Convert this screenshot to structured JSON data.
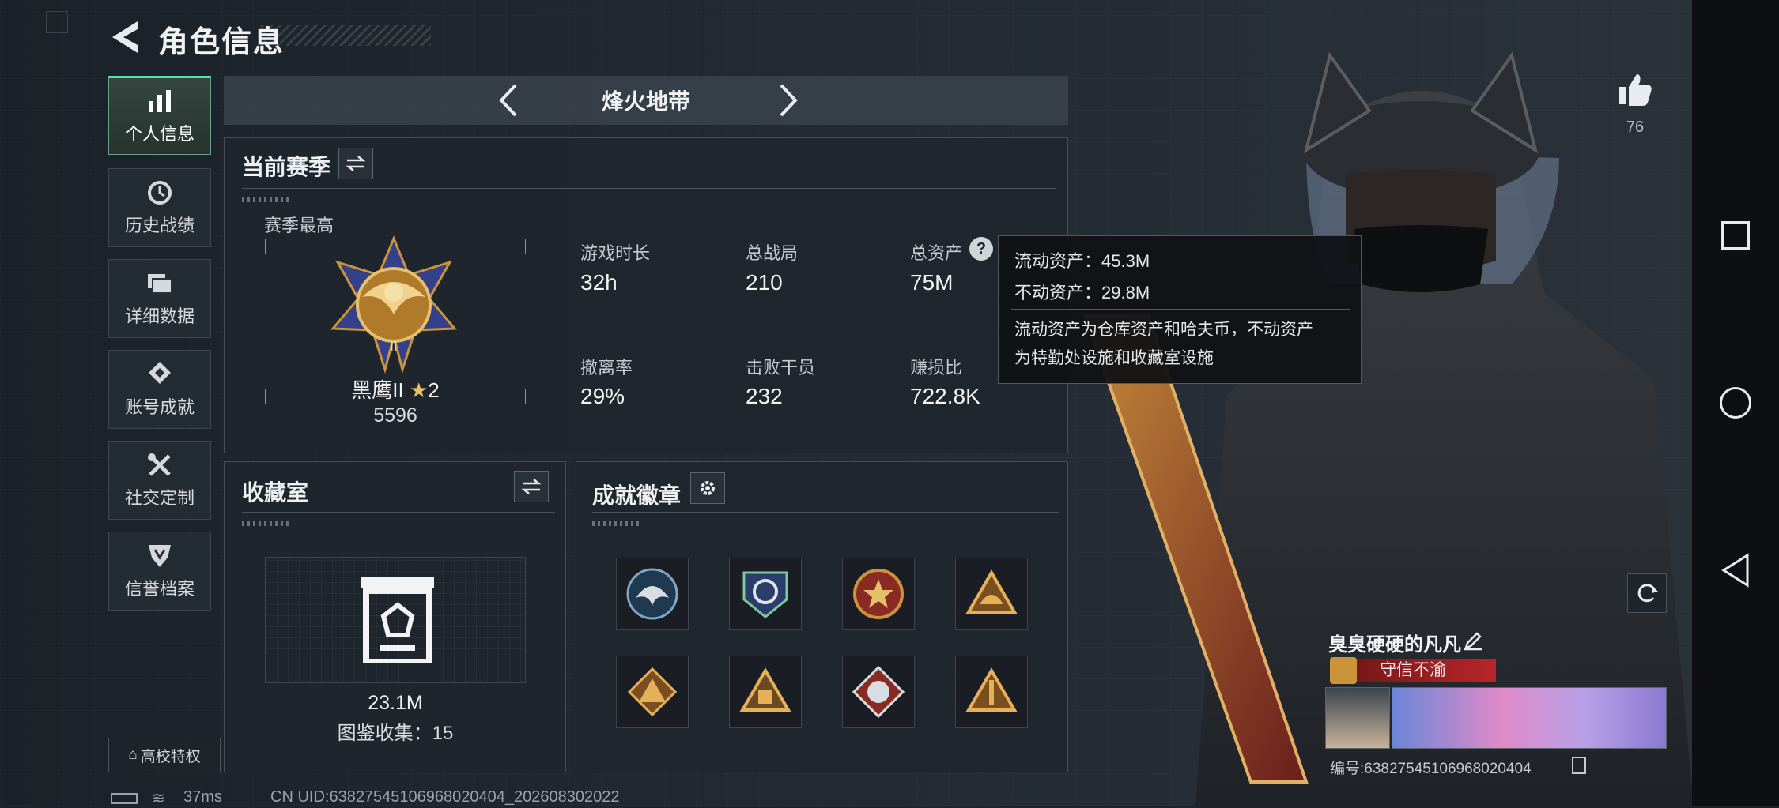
{
  "header": {
    "title": "角色信息"
  },
  "sidebar": {
    "items": [
      {
        "label": "个人信息",
        "icon": "bar-chart-icon",
        "active": true
      },
      {
        "label": "历史战绩",
        "icon": "history-icon"
      },
      {
        "label": "详细数据",
        "icon": "folder-icon"
      },
      {
        "label": "账号成就",
        "icon": "achievement-icon"
      },
      {
        "label": "社交定制",
        "icon": "tools-icon"
      },
      {
        "label": "信誉档案",
        "icon": "shield-icon"
      }
    ],
    "school_label": "高校特权"
  },
  "mode_bar": {
    "title": "烽火地带"
  },
  "season": {
    "title": "当前赛季",
    "highest_label": "赛季最高",
    "rank_name": "黑鹰II",
    "rank_stars": "2",
    "rank_score": "5596",
    "stats": [
      {
        "label": "游戏时长",
        "value": "32h"
      },
      {
        "label": "总战局",
        "value": "210"
      },
      {
        "label": "总资产",
        "value": "75M"
      },
      {
        "label": "撤离率",
        "value": "29%"
      },
      {
        "label": "击败干员",
        "value": "232"
      },
      {
        "label": "赚损比",
        "value": "722.8K"
      }
    ]
  },
  "tooltip": {
    "liquid": "流动资产：45.3M",
    "fixed": "不动资产：29.8M",
    "desc_line1": "流动资产为仓库资产和哈夫币，不动资产",
    "desc_line2": "为特勤处设施和收藏室设施"
  },
  "collection": {
    "title": "收藏室",
    "value": "23.1M",
    "count_text": "图鉴收集：15"
  },
  "badges": {
    "title": "成就徽章",
    "items": [
      "eagle-badge",
      "globe-badge",
      "star-badge",
      "triangle-badge-1",
      "triangle-badge-2",
      "triangle-badge-3",
      "wolf-badge",
      "triangle-badge-4"
    ]
  },
  "player": {
    "name": "臭臭硬硬的凡凡",
    "tag": "守信不渝",
    "uid_text": "编号:6382754510696802040​4"
  },
  "likes": {
    "count": "76"
  },
  "status": {
    "ping": "37ms",
    "cn_uid": "CN UID:6382754510696802040​4_202608302022"
  },
  "colors": {
    "accent": "#5ce0a6",
    "tag_red": "#b8262a",
    "badge_gold": "#c9943a"
  }
}
